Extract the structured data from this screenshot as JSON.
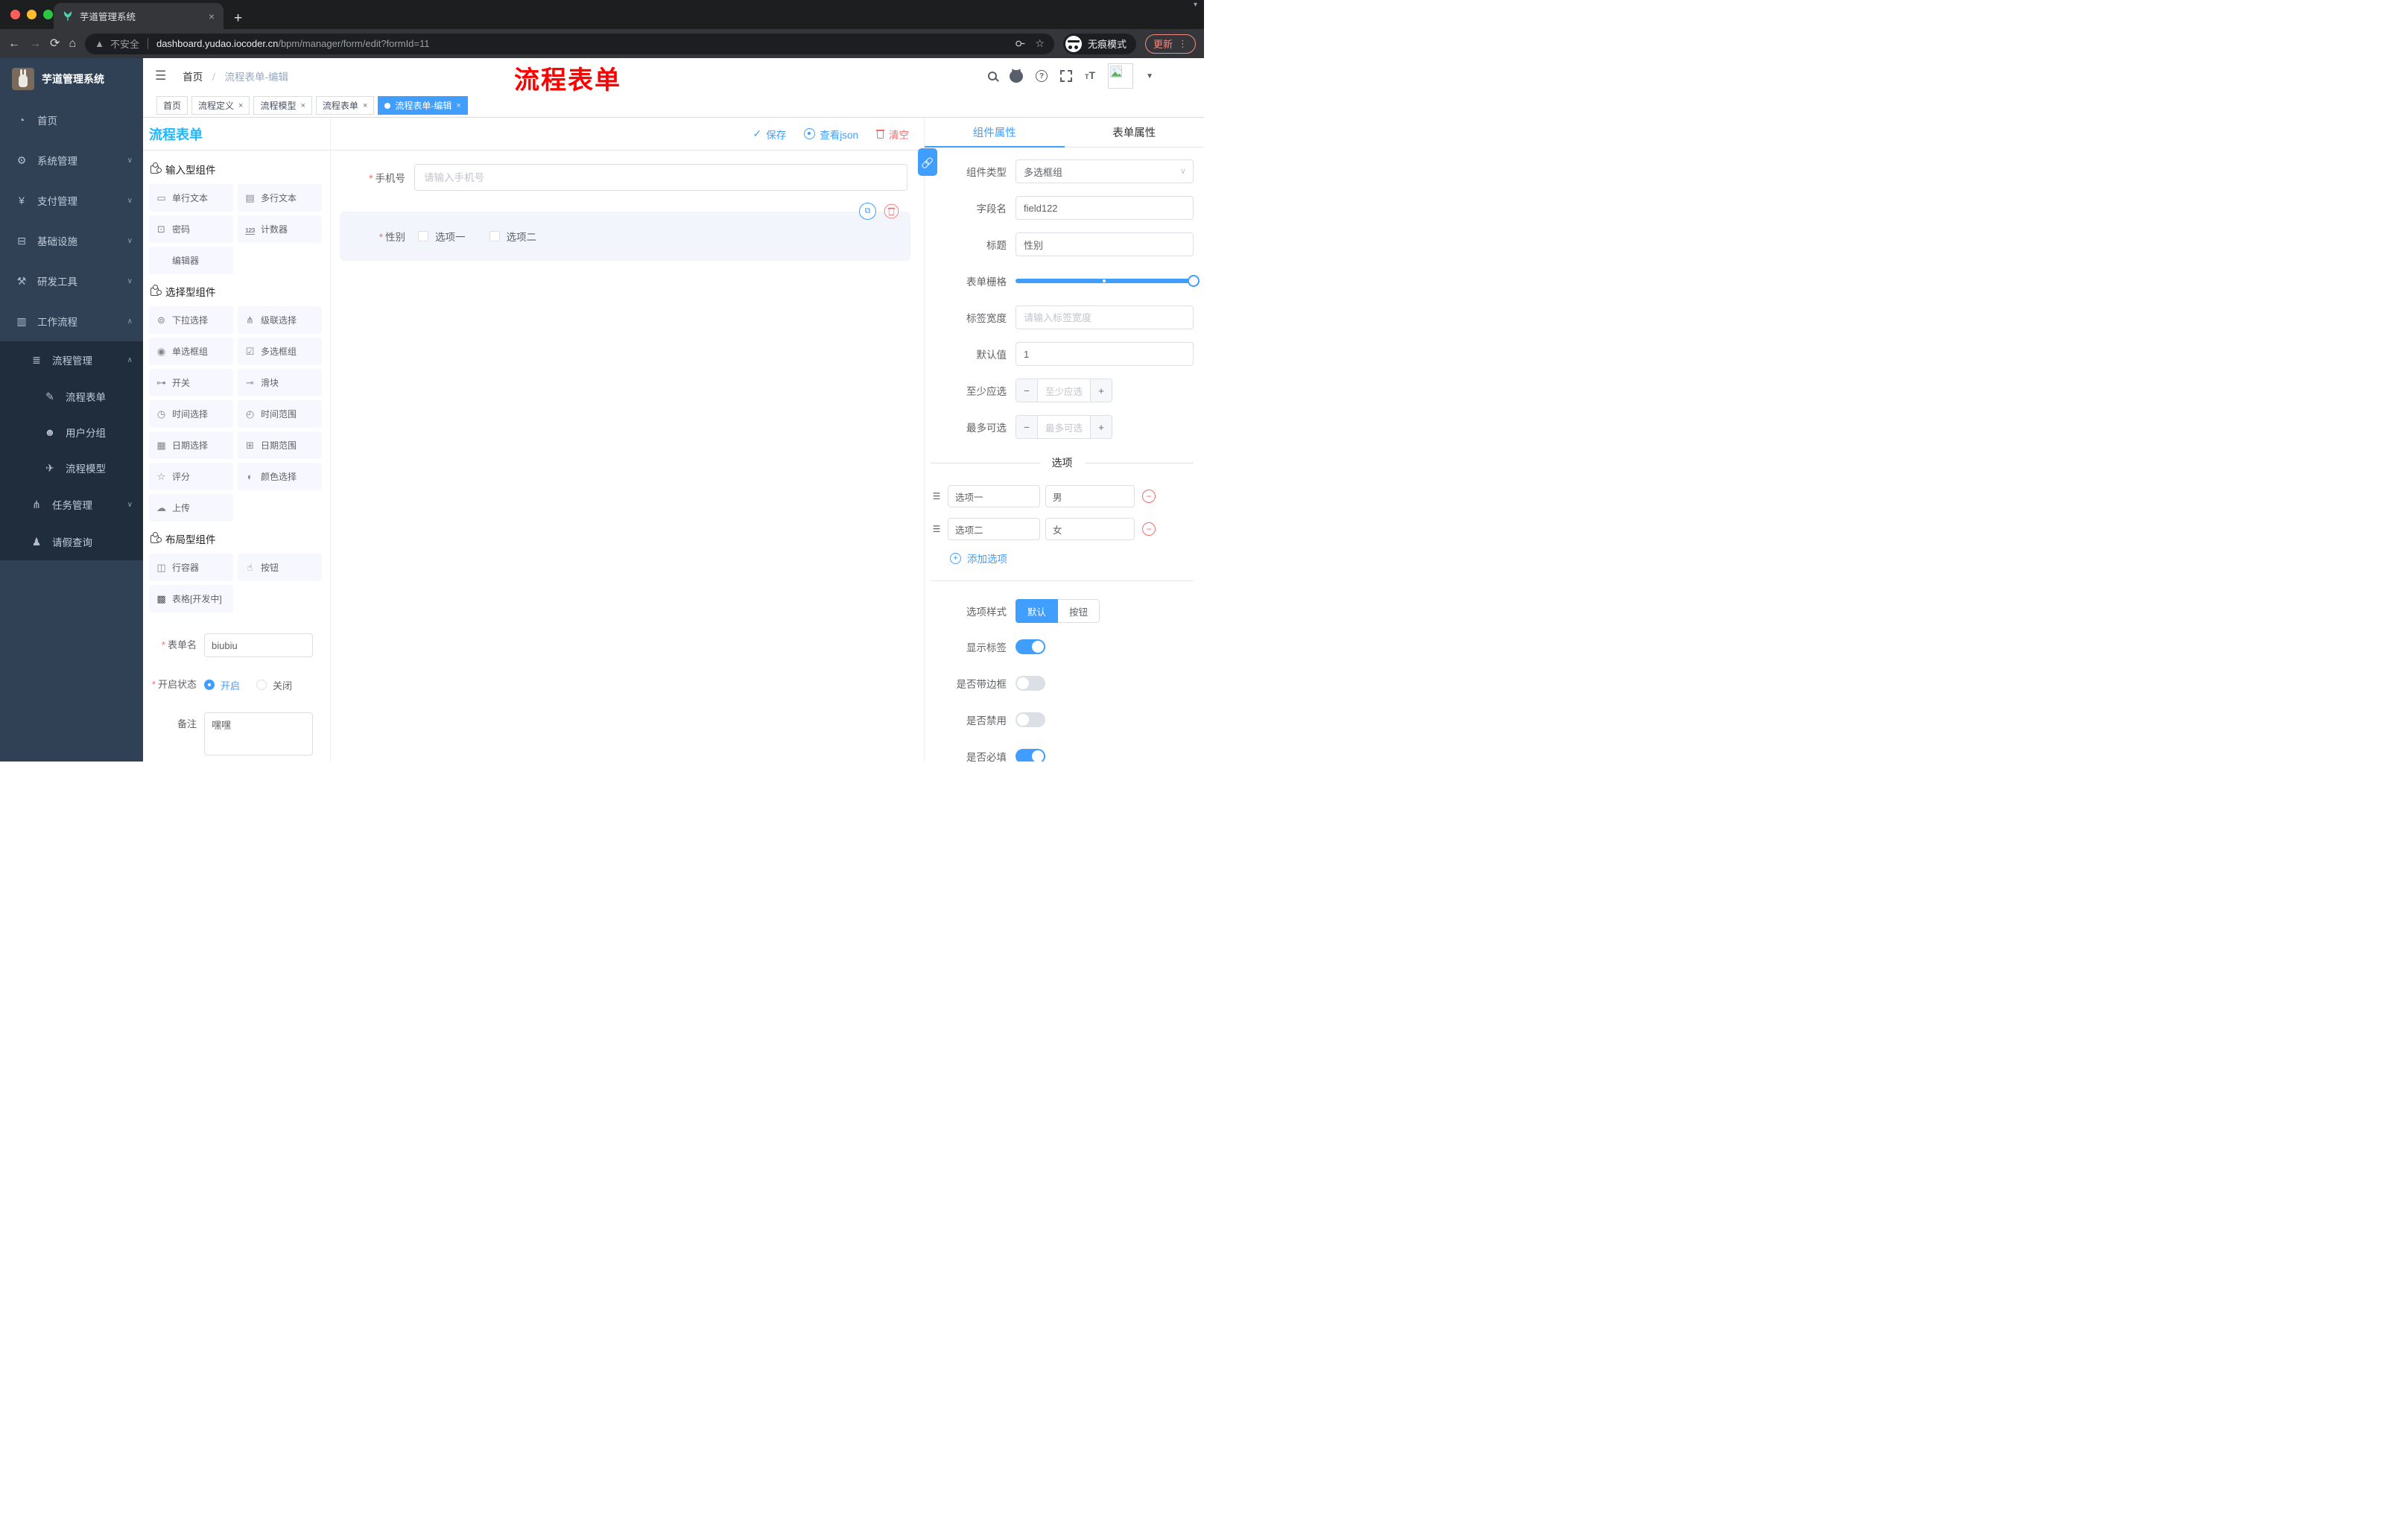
{
  "browser": {
    "tab_title": "芋道管理系统",
    "security_label": "不安全",
    "url_host": "dashboard.yudao.iocoder.cn",
    "url_path": "/bpm/manager/form/edit?formId=11",
    "incognito_label": "无痕模式",
    "update_label": "更新"
  },
  "sidebar": {
    "logo_title": "芋道管理系统",
    "items": [
      {
        "label": "首页",
        "icon": "dashboard-icon",
        "level": 1
      },
      {
        "label": "系统管理",
        "icon": "gear-icon",
        "level": 1,
        "chevron": "down"
      },
      {
        "label": "支付管理",
        "icon": "yen-icon",
        "level": 1,
        "chevron": "down"
      },
      {
        "label": "基础设施",
        "icon": "monitor-icon",
        "level": 1,
        "chevron": "down"
      },
      {
        "label": "研发工具",
        "icon": "tools-icon",
        "level": 1,
        "chevron": "down"
      },
      {
        "label": "工作流程",
        "icon": "briefcase-icon",
        "level": 1,
        "chevron": "up"
      },
      {
        "label": "流程管理",
        "icon": "list-tree-icon",
        "level": 2,
        "chevron": "up",
        "dark": true
      },
      {
        "label": "流程表单",
        "icon": "doc-edit-icon",
        "level": 3,
        "dark": true
      },
      {
        "label": "用户分组",
        "icon": "robot-icon",
        "level": 3,
        "dark": true
      },
      {
        "label": "流程模型",
        "icon": "paper-plane-icon",
        "level": 3,
        "dark": true
      },
      {
        "label": "任务管理",
        "icon": "branch-icon",
        "level": 2,
        "chevron": "down",
        "dark": true
      },
      {
        "label": "请假查询",
        "icon": "user-icon",
        "level": 2,
        "dark": true
      }
    ]
  },
  "navbar": {
    "breadcrumb": [
      "首页",
      "流程表单-编辑"
    ],
    "annotation": "流程表单"
  },
  "tags": [
    {
      "label": "首页",
      "closable": false,
      "active": false
    },
    {
      "label": "流程定义",
      "closable": true,
      "active": false
    },
    {
      "label": "流程模型",
      "closable": true,
      "active": false
    },
    {
      "label": "流程表单",
      "closable": true,
      "active": false
    },
    {
      "label": "流程表单-编辑",
      "closable": true,
      "active": true
    }
  ],
  "designer": {
    "panel_title": "流程表单",
    "toolbar": {
      "save": "保存",
      "view_json": "查看json",
      "clear": "清空"
    },
    "component_groups": [
      {
        "title": "输入型组件",
        "items": [
          {
            "label": "单行文本",
            "icon": "input-icon"
          },
          {
            "label": "多行文本",
            "icon": "textarea-icon"
          },
          {
            "label": "密码",
            "icon": "password-icon"
          },
          {
            "label": "计数器",
            "icon": "counter-icon"
          },
          {
            "label": "编辑器",
            "icon": "editor-icon"
          }
        ]
      },
      {
        "title": "选择型组件",
        "items": [
          {
            "label": "下拉选择",
            "icon": "select-icon"
          },
          {
            "label": "级联选择",
            "icon": "cascader-icon"
          },
          {
            "label": "单选框组",
            "icon": "radio-icon"
          },
          {
            "label": "多选框组",
            "icon": "checkbox-icon"
          },
          {
            "label": "开关",
            "icon": "switch-icon"
          },
          {
            "label": "滑块",
            "icon": "slider-icon"
          },
          {
            "label": "时间选择",
            "icon": "time-icon"
          },
          {
            "label": "时间范围",
            "icon": "time-range-icon"
          },
          {
            "label": "日期选择",
            "icon": "date-icon"
          },
          {
            "label": "日期范围",
            "icon": "date-range-icon"
          },
          {
            "label": "评分",
            "icon": "rate-icon"
          },
          {
            "label": "颜色选择",
            "icon": "color-icon"
          },
          {
            "label": "上传",
            "icon": "upload-icon"
          }
        ]
      },
      {
        "title": "布局型组件",
        "items": [
          {
            "label": "行容器",
            "icon": "row-icon"
          },
          {
            "label": "按钮",
            "icon": "button-icon"
          },
          {
            "label": "表格[开发中]",
            "icon": "table-icon"
          }
        ]
      }
    ],
    "meta_form": {
      "name_label": "表单名",
      "name_value": "biubiu",
      "status_label": "开启状态",
      "status_options": [
        "开启",
        "关闭"
      ],
      "status_selected": "开启",
      "remark_label": "备注",
      "remark_value": "嘿嘿"
    },
    "canvas": {
      "fields": [
        {
          "label": "手机号",
          "required": true,
          "type": "input",
          "placeholder": "请输入手机号"
        },
        {
          "label": "性别",
          "required": true,
          "type": "checkbox-group",
          "options": [
            "选项一",
            "选项二"
          ]
        }
      ]
    }
  },
  "props_panel": {
    "tabs": [
      {
        "label": "组件属性",
        "active": true
      },
      {
        "label": "表单属性",
        "active": false
      }
    ],
    "component_type_label": "组件类型",
    "component_type_value": "多选框组",
    "field_name_label": "字段名",
    "field_name_value": "field122",
    "title_label": "标题",
    "title_value": "性别",
    "grid_label": "表单栅格",
    "label_width_label": "标签宽度",
    "label_width_placeholder": "请输入标签宽度",
    "default_label": "默认值",
    "default_value": "1",
    "min_label": "至少应选",
    "min_placeholder": "至少应选",
    "max_label": "最多可选",
    "max_placeholder": "最多可选",
    "options_divider": "选项",
    "options": [
      {
        "label": "选项一",
        "value": "男"
      },
      {
        "label": "选项二",
        "value": "女"
      }
    ],
    "add_option_label": "添加选项",
    "style_label": "选项样式",
    "style_options": [
      "默认",
      "按钮"
    ],
    "style_selected": "默认",
    "toggles": [
      {
        "label": "显示标签",
        "on": true
      },
      {
        "label": "是否带边框",
        "on": false
      },
      {
        "label": "是否禁用",
        "on": false
      },
      {
        "label": "是否必填",
        "on": true
      }
    ]
  },
  "colors": {
    "accent": "#409eff",
    "panel_title": "#1fb7ff",
    "danger": "#f56c6c",
    "sidebar_bg": "#304156",
    "submenu_bg": "#1f2d3d",
    "annotation": "#fe0000"
  }
}
